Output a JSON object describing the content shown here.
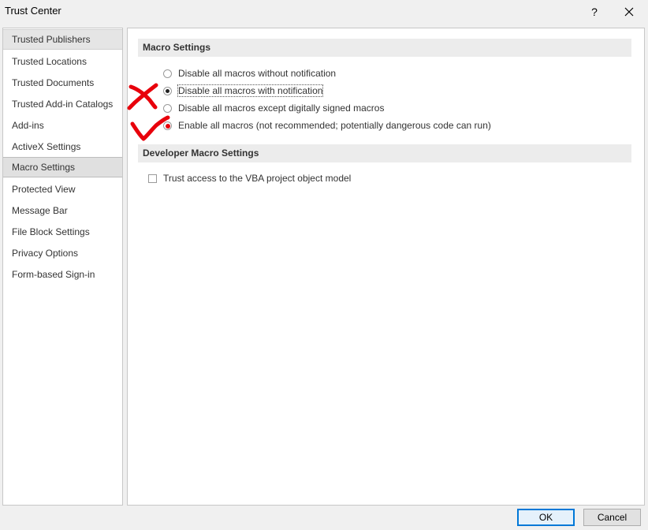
{
  "window": {
    "title": "Trust Center",
    "help_label": "?"
  },
  "sidebar": {
    "items": [
      {
        "label": "Trusted Publishers"
      },
      {
        "label": "Trusted Locations"
      },
      {
        "label": "Trusted Documents"
      },
      {
        "label": "Trusted Add-in Catalogs"
      },
      {
        "label": "Add-ins"
      },
      {
        "label": "ActiveX Settings"
      },
      {
        "label": "Macro Settings"
      },
      {
        "label": "Protected View"
      },
      {
        "label": "Message Bar"
      },
      {
        "label": "File Block Settings"
      },
      {
        "label": "Privacy Options"
      },
      {
        "label": "Form-based Sign-in"
      }
    ]
  },
  "macro_settings": {
    "header": "Macro Settings",
    "options": [
      {
        "label": "Disable all macros without notification",
        "checked": false
      },
      {
        "label": "Disable all macros with notification",
        "checked": true
      },
      {
        "label": "Disable all macros except digitally signed macros",
        "checked": false
      },
      {
        "label": "Enable all macros (not recommended; potentially dangerous code can run)",
        "checked": false
      }
    ]
  },
  "developer_settings": {
    "header": "Developer Macro Settings",
    "vba_access_label": "Trust access to the VBA project object model",
    "vba_access_checked": false
  },
  "buttons": {
    "ok": "OK",
    "cancel": "Cancel"
  },
  "annotation_color": "#e8000b"
}
